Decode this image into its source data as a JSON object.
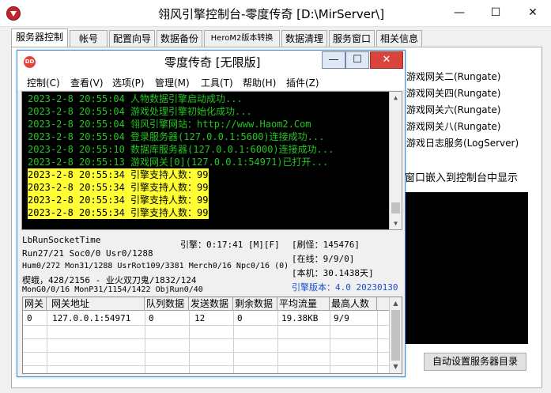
{
  "outer_window": {
    "title": "翎风引擎控制台-零度传奇 [D:\\MirServer\\]",
    "minimize_symbol": "—",
    "maximize_symbol": "☐",
    "close_symbol": "✕"
  },
  "tabs": [
    "服务器控制",
    "帐号",
    "配置向导",
    "数据备份",
    "HeroM2版本转换",
    "数据清理",
    "服务窗口",
    "相关信息"
  ],
  "right_panel": {
    "gateway_items": [
      "游戏网关二(Rungate)",
      "游戏网关四(Rungate)",
      "游戏网关六(Rungate)",
      "游戏网关八(Rungate)",
      "游戏日志服务(LogServer)"
    ],
    "embed_label": "窗口嵌入到控制台中显示",
    "auto_set_button": "自动设置服务器目录"
  },
  "inner_window": {
    "logo_text": "DD",
    "title": "零度传奇 [无限版]",
    "minimize_symbol": "—",
    "maximize_symbol": "☐",
    "close_symbol": "✕"
  },
  "menu": [
    "控制(C)",
    "查看(V)",
    "选项(P)",
    "管理(M)",
    "工具(T)",
    "帮助(H)",
    "插件(Z)"
  ],
  "console_lines": [
    {
      "text": "2023-2-8 20:55:04 人物数据引擎启动成功...",
      "highlight": false
    },
    {
      "text": "2023-2-8 20:55:04 游戏处理引擎初始化成功...",
      "highlight": false
    },
    {
      "text": "2023-2-8 20:55:04 翎风引擎网站：http://www.Haom2.Com",
      "highlight": false
    },
    {
      "text": "2023-2-8 20:55:04 登录服务器(127.0.0.1:5600)连接成功...",
      "highlight": false
    },
    {
      "text": "2023-2-8 20:55:10 数据库服务器(127.0.0.1:6000)连接成功...",
      "highlight": false
    },
    {
      "text": "2023-2-8 20:55:13 游戏网关[0](127.0.0.1:54971)已打开...",
      "highlight": false
    },
    {
      "text": "2023-2-8 20:55:34 引擎支持人数：99",
      "highlight": true
    },
    {
      "text": "2023-2-8 20:55:34 引擎支持人数：99",
      "highlight": true
    },
    {
      "text": "2023-2-8 20:55:34 引擎支持人数：99",
      "highlight": true
    },
    {
      "text": "2023-2-8 20:55:34 引擎支持人数：99",
      "highlight": true
    }
  ],
  "status": {
    "line1": "LbRunSocketTime",
    "line2": "Run27/21 Soc0/0 Usr0/1288",
    "line3": "Hum0/272 Mon31/1288 UsrRot109/3381 Merch0/16 Npc0/16 (0)",
    "line4": "楔蛾，428/2156 - 业火双刀鬼/1832/124",
    "line5": "MonG0/0/16 MonP31/1154/1422 ObjRun0/40",
    "engine_time": "引擎：0:17:41 [M][F]",
    "refresh_monster": "[刷怪：145476]",
    "online": "[在线：9/9/0]",
    "local_machine": "[本机：30.1438天]",
    "engine_version": "引擎版本：4.0 20230130"
  },
  "grid": {
    "headers": [
      "网关",
      "网关地址",
      "队列数据",
      "发送数据",
      "剩余数据",
      "平均流量",
      "最高人数"
    ],
    "rows": [
      [
        "0",
        "127.0.0.1:54971",
        "0",
        "12",
        "0",
        "19.38KB",
        "9/9"
      ]
    ]
  },
  "colors": {
    "console_text": "#22c522",
    "highlight_bg": "#ffff33",
    "accent": "#1a4fd1",
    "brand_red": "#c0272d"
  }
}
